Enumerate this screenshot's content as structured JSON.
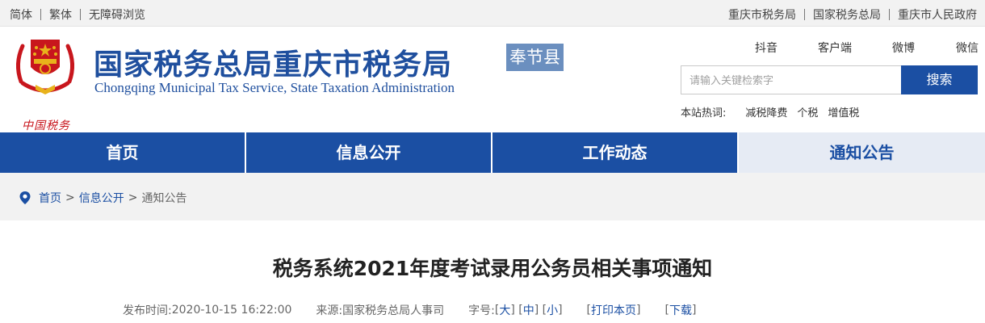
{
  "topbar": {
    "left_links": [
      "简体",
      "繁体",
      "无障碍浏览"
    ],
    "right_links": [
      "重庆市税务局",
      "国家税务总局",
      "重庆市人民政府"
    ]
  },
  "header": {
    "logo_text": "中国税务",
    "title_cn": "国家税务总局重庆市税务局",
    "title_en": "Chongqing Municipal Tax Service, State Taxation Administration",
    "county_label": "奉节县",
    "social_links": [
      "抖音",
      "客户端",
      "微博",
      "微信"
    ],
    "search": {
      "placeholder": "请输入关键检索字",
      "button_label": "搜索"
    },
    "hot": {
      "label": "本站热词:",
      "keywords": [
        "减税降费",
        "个税",
        "增值税"
      ]
    }
  },
  "nav": {
    "items": [
      "首页",
      "信息公开",
      "工作动态",
      "通知公告"
    ],
    "active_index": 3
  },
  "breadcrumb": {
    "home": "首页",
    "section": "信息公开",
    "current": "通知公告",
    "separator": ">"
  },
  "article": {
    "title": "税务系统2021年度考试录用公务员相关事项通知",
    "meta": {
      "publish_label": "发布时间:",
      "publish_time": "2020-10-15 16:22:00",
      "source_label": "来源:",
      "source": "国家税务总局人事司",
      "font_label": "字号:",
      "font_large": "大",
      "font_medium": "中",
      "font_small": "小",
      "print_label": "打印本页",
      "download_label": "下载"
    }
  },
  "colors": {
    "brand_blue": "#1b4fa3",
    "nav_active_bg": "#e6ebf4",
    "county_bg": "#6b8fbf",
    "emblem_red": "#c8161d",
    "emblem_gold": "#e8b21b"
  }
}
